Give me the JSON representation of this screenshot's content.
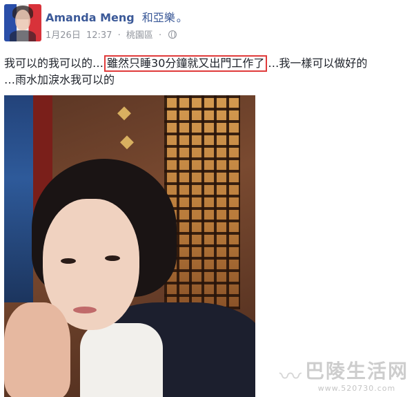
{
  "post": {
    "author": "Amanda Meng",
    "with": "和亞樂",
    "with_suffix": "。",
    "date": "1月26日",
    "time": "12:37",
    "separator": "·",
    "location": "桃園區",
    "privacy_icon": "globe-icon",
    "text": {
      "line1_before": "我可以的我可以的…",
      "line1_highlight": "雖然只睡30分鐘就又出門工作了",
      "line1_after": "…我一樣可以做好的",
      "line2": "…雨水加淚水我可以的"
    },
    "highlight_color": "#e03a3a",
    "link_color": "#3b5998"
  },
  "watermark": {
    "logo_glyph": "〰",
    "title": "巴陵生活网",
    "url": "www.520730.com"
  }
}
